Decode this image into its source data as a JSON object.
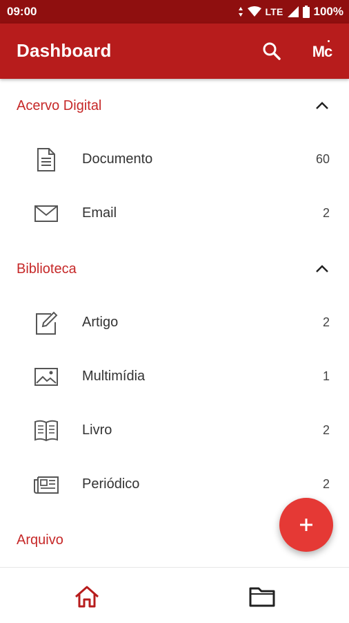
{
  "status_bar": {
    "time": "09:00",
    "network": "LTE",
    "battery": "100%"
  },
  "app_bar": {
    "title": "Dashboard",
    "avatar_initials": "Mc"
  },
  "sections": [
    {
      "title": "Acervo Digital",
      "items": [
        {
          "label": "Documento",
          "count": "60",
          "icon": "document-icon"
        },
        {
          "label": "Email",
          "count": "2",
          "icon": "email-icon"
        }
      ]
    },
    {
      "title": "Biblioteca",
      "items": [
        {
          "label": "Artigo",
          "count": "2",
          "icon": "edit-icon"
        },
        {
          "label": "Multimídia",
          "count": "1",
          "icon": "image-icon"
        },
        {
          "label": "Livro",
          "count": "2",
          "icon": "book-icon"
        },
        {
          "label": "Periódico",
          "count": "2",
          "icon": "newspaper-icon"
        }
      ]
    },
    {
      "title": "Arquivo",
      "items": []
    }
  ],
  "colors": {
    "status_bar": "#8f0f0f",
    "app_bar": "#b71c1c",
    "accent": "#c62828",
    "fab": "#e53935"
  }
}
